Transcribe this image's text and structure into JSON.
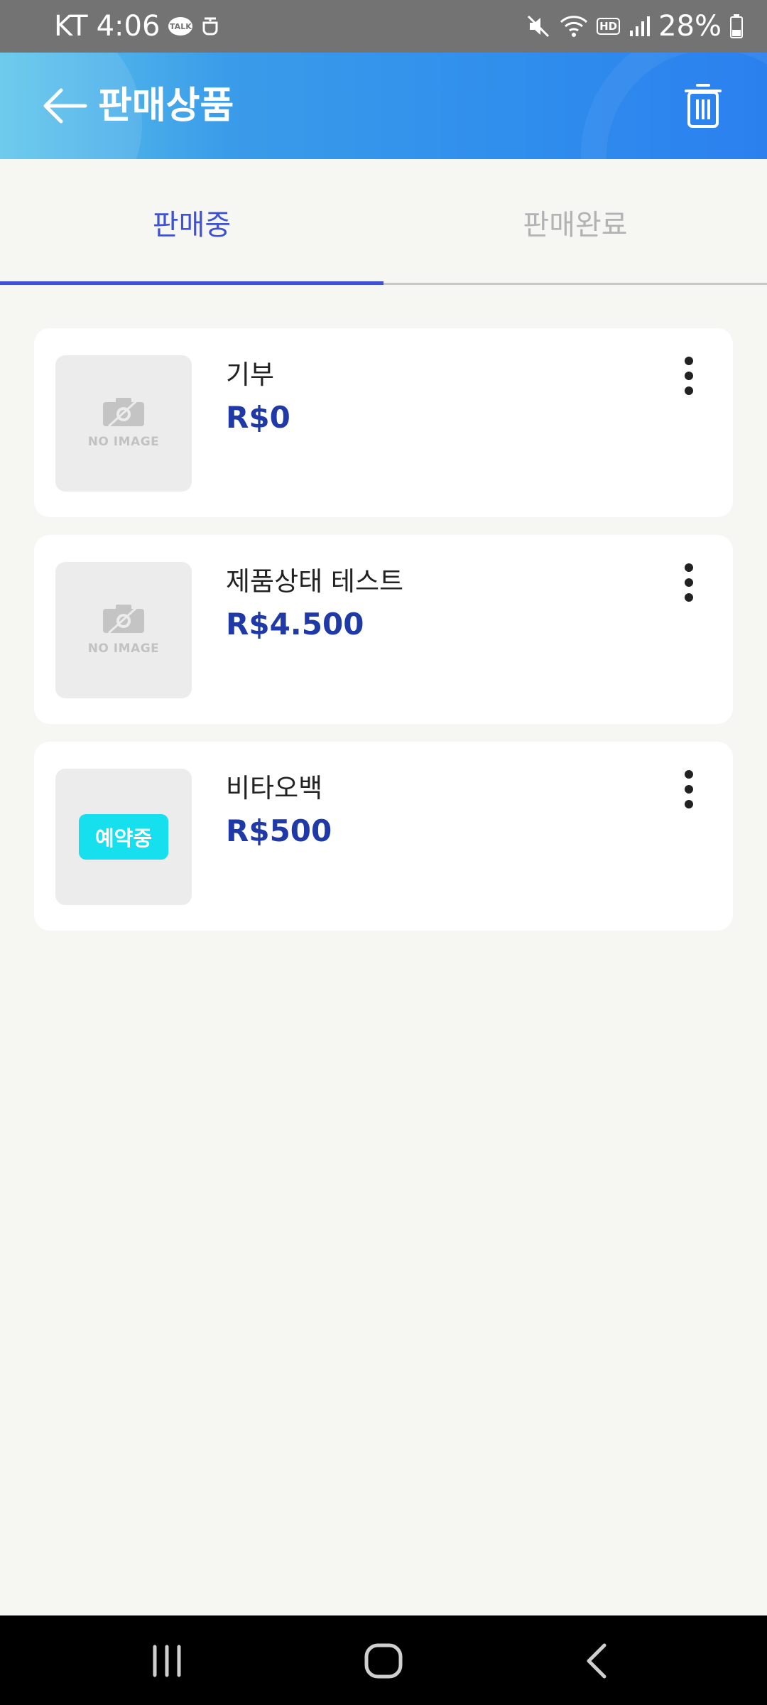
{
  "status_bar": {
    "carrier": "KT",
    "time": "4:06",
    "talk_badge": "TALK",
    "hd_label": "HD",
    "battery": "28%"
  },
  "header": {
    "title": "판매상품",
    "back_icon": "arrow-left-icon",
    "trash_icon": "trash-icon"
  },
  "tabs": [
    {
      "label": "판매중",
      "active": true
    },
    {
      "label": "판매완료",
      "active": false
    }
  ],
  "products": [
    {
      "title": "기부",
      "price": "R$0",
      "thumbnail": "NO IMAGE"
    },
    {
      "title": "제품상태 테스트",
      "price": "R$4.500",
      "thumbnail": "NO IMAGE"
    },
    {
      "title": "비타오백",
      "price": "R$500",
      "badge": "예약중"
    }
  ],
  "colors": {
    "accent": "#3f51d5",
    "price": "#1f3aa6",
    "badge": "#16e0ee",
    "header_start": "#5ec6ea",
    "header_end": "#2b80ee"
  }
}
